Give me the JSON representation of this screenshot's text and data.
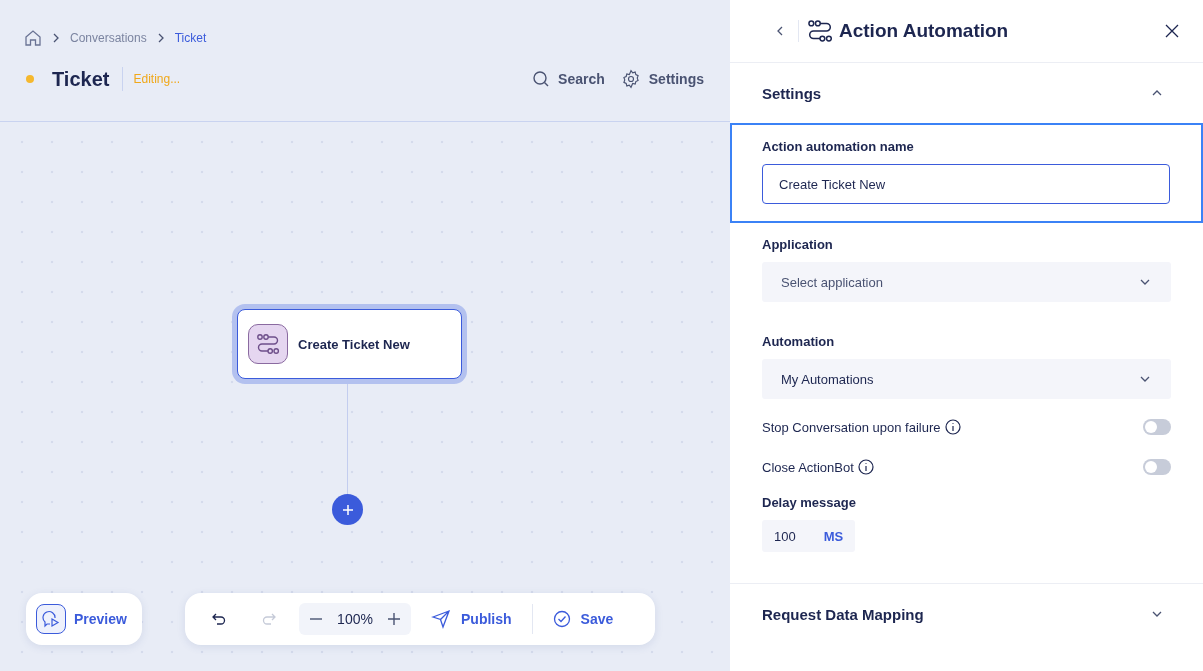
{
  "breadcrumb": [
    {
      "label": "Conversations",
      "current": false
    },
    {
      "label": "Ticket",
      "current": true
    }
  ],
  "header": {
    "title": "Ticket",
    "status": "Editing...",
    "actions": [
      {
        "label": "Search",
        "kind": "search"
      },
      {
        "label": "Settings",
        "kind": "settings"
      }
    ]
  },
  "canvas": {
    "node": {
      "label": "Create Ticket New",
      "selected": true
    }
  },
  "toolbar": {
    "preview": "Preview",
    "undo_disabled": false,
    "redo_disabled": true,
    "zoom": "100%",
    "publish": "Publish",
    "save": "Save"
  },
  "panel": {
    "title": "Action Automation",
    "settings": {
      "title": "Settings",
      "expanded": true,
      "name_label": "Action automation name",
      "name_value": "Create Ticket New",
      "selects": [
        {
          "label": "Application",
          "value": "Select application",
          "placeholder": true
        },
        {
          "label": "Automation",
          "value": "My Automations",
          "placeholder": false
        }
      ],
      "toggles": [
        {
          "label": "Stop Conversation upon failure",
          "on": false
        },
        {
          "label": "Close ActionBot",
          "on": false
        }
      ],
      "delay_label": "Delay message",
      "delay_value": "100",
      "delay_unit": "MS"
    },
    "mapping": {
      "title": "Request Data Mapping",
      "expanded": false
    }
  }
}
